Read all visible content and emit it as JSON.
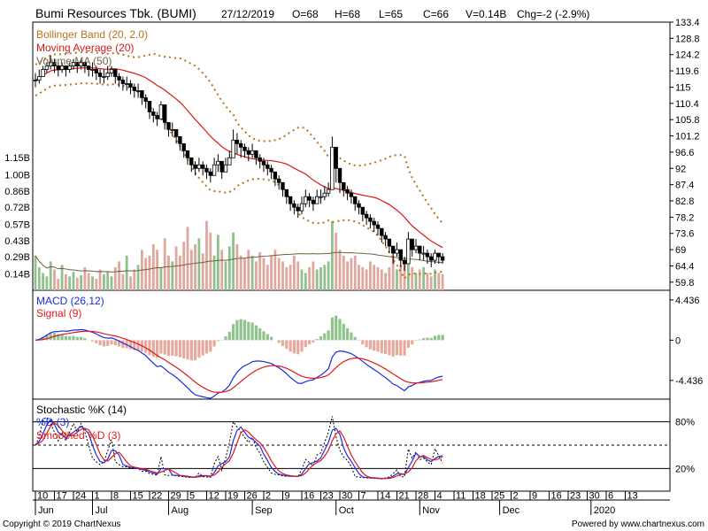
{
  "header": {
    "title": "Bumi Resources Tbk. (BUMI)",
    "date": "27/12/2019",
    "open": "O=68",
    "high": "H=68",
    "low": "L=65",
    "close": "C=66",
    "volume": "V=0.14B",
    "change": "Chg=-2 (-2.9%)"
  },
  "legend": {
    "bollinger": "Bollinger Band (20, 2.0)",
    "moving_average": "Moving Average (20)",
    "volume_ma": "Volume MA (50)",
    "macd": "MACD (26,12)",
    "signal": "Signal (9)",
    "stoch_k": "Stochastic %K (14)",
    "stoch_d": "%D (3)",
    "smoothed_d": "Smoothed %D (3)"
  },
  "footer": {
    "copyright": "Copyright © 2019 ChartNexus",
    "powered": "Powered by www.chartnexus.com"
  },
  "colors": {
    "up": "#ffffff",
    "down": "#000000",
    "bollinger": "#b8731e",
    "ma": "#d81818",
    "volma": "#6f5f3f",
    "vol_up": "#90c08e",
    "vol_down": "#dfa79d",
    "macd": "#1b2be0",
    "signal": "#e01818",
    "hist_up": "#8fc38c",
    "hist_down": "#e8a99c"
  },
  "chart_data": [
    {
      "type": "candlestick",
      "title": "Bumi Resources Tbk. (BUMI)",
      "price_ticks": [
        133.4,
        128.8,
        124.2,
        119.6,
        115,
        110.4,
        105.8,
        101.2,
        96.6,
        92,
        87.4,
        82.8,
        78.2,
        73.6,
        69,
        64.4,
        59.8
      ],
      "volume_ticks": [
        "1.15B",
        "1.00B",
        "0.86B",
        "0.72B",
        "0.57B",
        "0.43B",
        "0.29B",
        "0.14B"
      ],
      "ylim": [
        57.5,
        133.4
      ],
      "last": {
        "date": "27/12/2019",
        "open": 68,
        "high": 68,
        "low": 65,
        "close": 66,
        "volume": "0.14B"
      },
      "closes": [
        117,
        118,
        120,
        121,
        122,
        121,
        120,
        121,
        120,
        121,
        122,
        121,
        122,
        121,
        120,
        120,
        119,
        118,
        118,
        119,
        120,
        118,
        117,
        116,
        116,
        115,
        114,
        114,
        112,
        111,
        108,
        107,
        106,
        110,
        105,
        103,
        103,
        101,
        99,
        97,
        95,
        93,
        92,
        93,
        92,
        91,
        90,
        93,
        94,
        91,
        93,
        95,
        100,
        99,
        98,
        97,
        96,
        97,
        95,
        94,
        93,
        92,
        91,
        89,
        88,
        86,
        84,
        82,
        81,
        80,
        82,
        84,
        83,
        82,
        84,
        84,
        85,
        86,
        98,
        92,
        88,
        86,
        85,
        84,
        82,
        81,
        79,
        78,
        77,
        76,
        75,
        73,
        72,
        70,
        68,
        69,
        66,
        65,
        72,
        69,
        70,
        68,
        68,
        67,
        66,
        68,
        67,
        66
      ],
      "highs": [
        119,
        120,
        121,
        122,
        124,
        123,
        122,
        122,
        121,
        122,
        123,
        122,
        123,
        122,
        121,
        122,
        121,
        120,
        120,
        121,
        121,
        120,
        119,
        118,
        118,
        117,
        116,
        116,
        114,
        113,
        110,
        109,
        108,
        111,
        107,
        105,
        105,
        103,
        101,
        99,
        97,
        95,
        94,
        95,
        94,
        93,
        92,
        95,
        96,
        93,
        95,
        97,
        103,
        102,
        100,
        99,
        98,
        99,
        97,
        96,
        95,
        94,
        93,
        91,
        90,
        88,
        86,
        84,
        83,
        82,
        84,
        86,
        85,
        84,
        86,
        86,
        87,
        88,
        101,
        95,
        90,
        88,
        87,
        86,
        84,
        83,
        81,
        80,
        79,
        78,
        77,
        75,
        74,
        72,
        70,
        71,
        68,
        67,
        74,
        71,
        72,
        70,
        70,
        69,
        68,
        69,
        68,
        68
      ],
      "lows": [
        115,
        116,
        118,
        119,
        120,
        119,
        118,
        119,
        118,
        119,
        120,
        119,
        120,
        119,
        118,
        118,
        117,
        116,
        116,
        117,
        118,
        116,
        115,
        114,
        114,
        113,
        112,
        112,
        110,
        109,
        106,
        105,
        104,
        107,
        103,
        101,
        101,
        99,
        97,
        95,
        93,
        91,
        90,
        91,
        90,
        89,
        88,
        90,
        91,
        89,
        91,
        93,
        96,
        96,
        95,
        95,
        94,
        95,
        93,
        92,
        91,
        90,
        89,
        87,
        86,
        84,
        82,
        80,
        79,
        78,
        79,
        81,
        81,
        80,
        82,
        82,
        83,
        84,
        88,
        88,
        85,
        84,
        83,
        82,
        80,
        79,
        77,
        76,
        75,
        74,
        73,
        71,
        70,
        68,
        65,
        67,
        64,
        63,
        68,
        67,
        68,
        66,
        66,
        65,
        64,
        65,
        65,
        65
      ]
    },
    {
      "type": "bar",
      "title": "Volume",
      "values_b": [
        0.3,
        0.2,
        0.15,
        0.12,
        0.25,
        0.18,
        0.1,
        0.22,
        0.14,
        0.12,
        0.16,
        0.11,
        0.13,
        0.2,
        0.15,
        0.12,
        0.1,
        0.18,
        0.14,
        0.16,
        0.12,
        0.2,
        0.25,
        0.14,
        0.3,
        0.12,
        0.18,
        0.22,
        0.35,
        0.28,
        0.3,
        0.4,
        0.35,
        0.2,
        0.45,
        0.3,
        0.25,
        0.38,
        0.3,
        0.42,
        0.55,
        0.35,
        0.4,
        0.45,
        0.32,
        0.6,
        0.5,
        0.3,
        0.48,
        0.35,
        0.25,
        0.38,
        0.5,
        0.4,
        0.3,
        0.28,
        0.35,
        0.3,
        0.25,
        0.33,
        0.28,
        0.22,
        0.3,
        0.35,
        0.28,
        0.25,
        0.2,
        0.22,
        0.3,
        0.25,
        0.18,
        0.15,
        0.2,
        0.25,
        0.18,
        0.2,
        0.22,
        0.25,
        0.6,
        0.5,
        0.35,
        0.3,
        0.25,
        0.28,
        0.3,
        0.22,
        0.2,
        0.18,
        0.25,
        0.22,
        0.2,
        0.18,
        0.15,
        0.2,
        0.3,
        0.18,
        0.22,
        0.25,
        0.3,
        0.2,
        0.15,
        0.18,
        0.2,
        0.15,
        0.12,
        0.18,
        0.15,
        0.14
      ]
    },
    {
      "type": "line",
      "title": "MACD (26,12)",
      "y_ticks": [
        4.436,
        0,
        -4.436
      ],
      "ylim": [
        -6.5,
        5.5
      ]
    },
    {
      "type": "line",
      "title": "Stochastic %K (14)",
      "y_ticks": [
        "80%",
        "20%"
      ],
      "ylim": [
        0,
        100
      ]
    }
  ],
  "x_axis": {
    "days": [
      {
        "t": "10",
        "i": 0
      },
      {
        "t": "17",
        "i": 5
      },
      {
        "t": "24",
        "i": 10
      },
      {
        "t": "1",
        "i": 15
      },
      {
        "t": "8",
        "i": 20
      },
      {
        "t": "15",
        "i": 25
      },
      {
        "t": "22",
        "i": 30
      },
      {
        "t": "29",
        "i": 35
      },
      {
        "t": "5",
        "i": 40
      },
      {
        "t": "12",
        "i": 45
      },
      {
        "t": "19",
        "i": 50
      },
      {
        "t": "26",
        "i": 55
      },
      {
        "t": "2",
        "i": 60
      },
      {
        "t": "9",
        "i": 65
      },
      {
        "t": "16",
        "i": 70
      },
      {
        "t": "23",
        "i": 75
      },
      {
        "t": "30",
        "i": 80
      },
      {
        "t": "7",
        "i": 85
      },
      {
        "t": "14",
        "i": 90
      },
      {
        "t": "21",
        "i": 95
      },
      {
        "t": "28",
        "i": 100
      },
      {
        "t": "4",
        "i": 105
      },
      {
        "t": "11",
        "i": 110
      },
      {
        "t": "18",
        "i": 115
      },
      {
        "t": "25",
        "i": 120
      },
      {
        "t": "2",
        "i": 125
      },
      {
        "t": "9",
        "i": 130
      },
      {
        "t": "16",
        "i": 135
      },
      {
        "t": "23",
        "i": 140
      },
      {
        "t": "30",
        "i": 145
      },
      {
        "t": "6",
        "i": 150
      },
      {
        "t": "13",
        "i": 155
      }
    ],
    "months": [
      {
        "t": "Jun",
        "i": 0
      },
      {
        "t": "Jul",
        "i": 15
      },
      {
        "t": "Aug",
        "i": 35
      },
      {
        "t": "Sep",
        "i": 57
      },
      {
        "t": "Oct",
        "i": 79
      },
      {
        "t": "Nov",
        "i": 101
      },
      {
        "t": "Dec",
        "i": 122
      },
      {
        "t": "2020",
        "i": 146
      }
    ]
  }
}
